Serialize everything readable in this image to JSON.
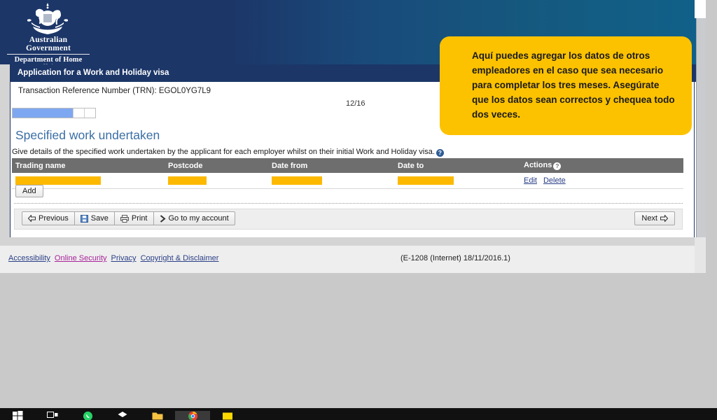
{
  "banner": {
    "crest_line1": "Australian Government",
    "crest_line2": "Department of Home Affairs",
    "crest_icon": "commonwealth-coat-of-arms"
  },
  "title_bar": {
    "title": "Application for a Work and Holiday visa"
  },
  "form": {
    "trn_label": "Transaction Reference Number (TRN): EGOL0YG7L9",
    "page_counter": "12/16",
    "progress_percent": 73,
    "section_title": "Specified work undertaken",
    "section_description": "Give details of the specified work undertaken by the applicant for each employer whilst on their initial Work and Holiday visa.",
    "help_glyph": "?"
  },
  "table": {
    "columns": [
      "Trading name",
      "Postcode",
      "Date from",
      "Date to",
      "Actions"
    ],
    "rows": [
      {
        "trading_name": "",
        "postcode": "",
        "date_from": "",
        "date_to": "",
        "actions": [
          "Edit",
          "Delete"
        ],
        "redacted": true
      }
    ]
  },
  "buttons": {
    "add": "Add",
    "previous": "Previous",
    "save": "Save",
    "print": "Print",
    "go_to_account": "Go to my account",
    "next": "Next",
    "previous_icon": "left-arrow-icon",
    "save_icon": "floppy-disk-icon",
    "print_icon": "printer-icon",
    "account_icon": "right-chevron-icon",
    "next_icon": "right-arrow-icon"
  },
  "footer": {
    "links": [
      "Accessibility",
      "Online Security",
      "Privacy",
      "Copyright & Disclaimer"
    ],
    "visited_link": "Online Security",
    "version": "(E-1208 (Internet) 18/11/2016.1)"
  },
  "callout": {
    "text": "Aquí puedes agregar los datos de otros empleadores en el caso que sea necesario para completar los tres meses. Asegúrate que los datos sean correctos y chequea todo dos veces."
  },
  "taskbar": {
    "items": [
      "windows-start-icon",
      "task-view-icon",
      "whatsapp-icon",
      "dropbox-icon",
      "file-explorer-icon",
      "chrome-icon",
      "sticky-notes-icon"
    ]
  },
  "colors": {
    "navy": "#1c3668",
    "banner_blue": "#10618a",
    "heading_blue": "#3a6ea5",
    "table_header_grey": "#6e6e6e",
    "redaction_yellow": "#fcb900",
    "callout_yellow": "#fcc200",
    "link_blue": "#2a3f86",
    "visited_purple": "#a8249a",
    "progress_blue": "#7da7f0"
  }
}
